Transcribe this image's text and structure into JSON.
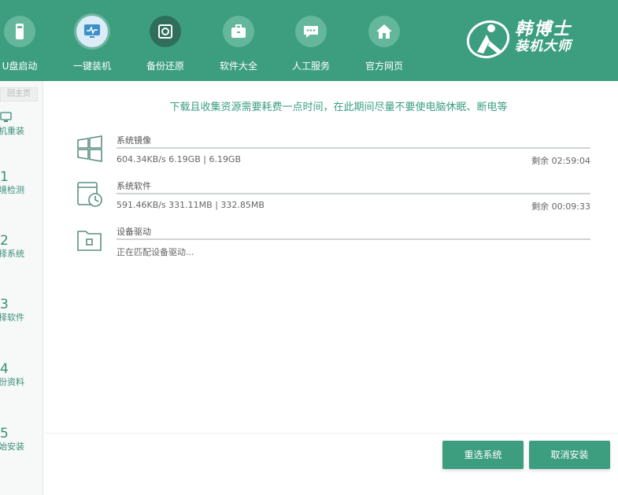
{
  "nav": [
    {
      "label": "U盘启动",
      "icon": "usb-drive-icon"
    },
    {
      "label": "一键装机",
      "icon": "monitor-icon",
      "active": true
    },
    {
      "label": "备份还原",
      "icon": "backup-icon"
    },
    {
      "label": "软件大全",
      "icon": "briefcase-icon"
    },
    {
      "label": "人工服务",
      "icon": "chat-icon"
    },
    {
      "label": "官方网页",
      "icon": "home-icon"
    }
  ],
  "brand": {
    "line1": "韩博士",
    "line2": "装机大师"
  },
  "sidebar": {
    "home": "回主页",
    "steps": [
      {
        "num": "",
        "label": "机重装"
      },
      {
        "num": "1",
        "label": "境检测"
      },
      {
        "num": "2",
        "label": "择系统"
      },
      {
        "num": "3",
        "label": "择软件"
      },
      {
        "num": "4",
        "label": "份资料"
      },
      {
        "num": "5",
        "label": "始安装"
      }
    ]
  },
  "main": {
    "title": "下载且收集资源需要耗费一点时间，在此期间尽量不要使电脑休眠、断电等",
    "downloads": [
      {
        "name": "系统镜像",
        "info": "604.34KB/s 6.19GB | 6.19GB",
        "remain": "剩余 02:59:04",
        "progress": 1.0,
        "icon": "windows-icon"
      },
      {
        "name": "系统软件",
        "info": "591.46KB/s 331.11MB | 332.85MB",
        "remain": "剩余 00:09:33",
        "progress": 1.0,
        "icon": "software-clock-icon"
      },
      {
        "name": "设备驱动",
        "info": "正在匹配设备驱动...",
        "remain": "",
        "progress": 1.0,
        "icon": "driver-folder-icon"
      }
    ]
  },
  "buttons": {
    "reselect": "重选系统",
    "cancel": "取消安装"
  },
  "colors": {
    "brand": "#3d9e7f",
    "accent_text": "#3a9e82"
  }
}
